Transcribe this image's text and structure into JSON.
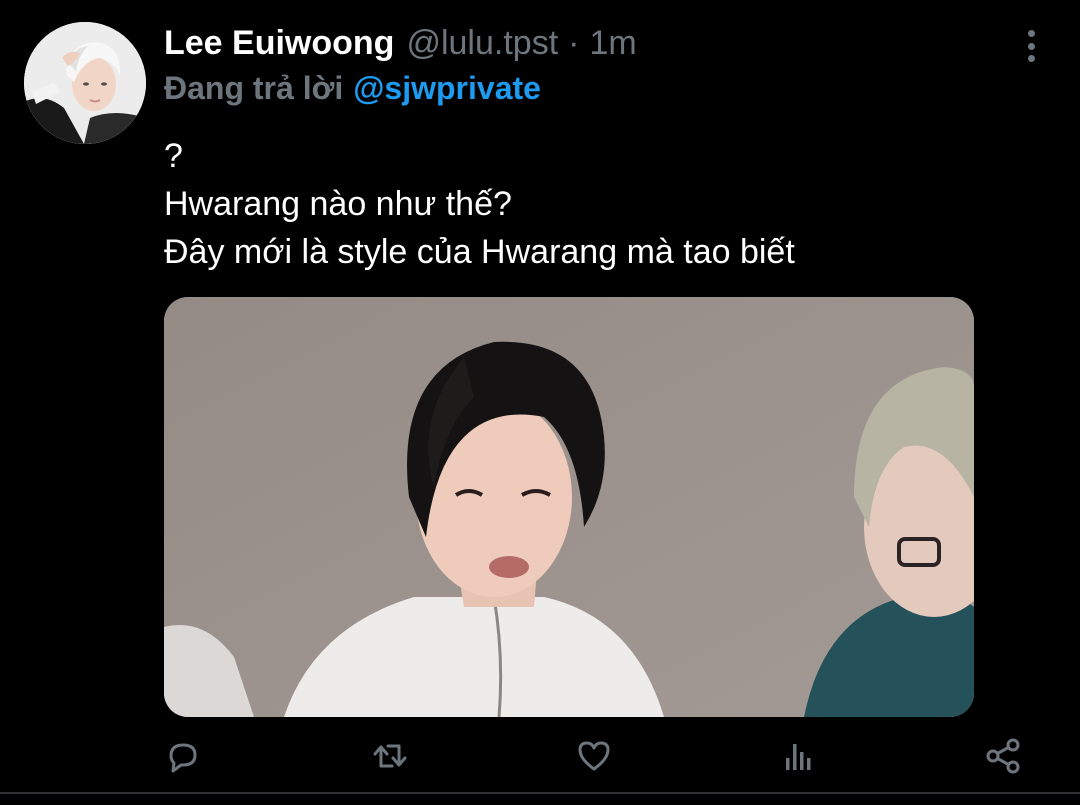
{
  "author": {
    "display_name": "Lee Euiwoong",
    "handle": "@lulu.tpst",
    "separator": "·",
    "time": "1m"
  },
  "reply": {
    "prefix": "Đang trả lời",
    "mention": "@sjwprivate"
  },
  "tweet": {
    "lines": [
      "?",
      "Hwarang nào như thế?",
      "Đây mới là style của Hwarang mà tao biết"
    ]
  },
  "actions": {
    "reply": "reply-icon",
    "retweet": "retweet-icon",
    "like": "heart-icon",
    "analytics": "analytics-icon",
    "share": "share-icon"
  },
  "colors": {
    "background": "#000000",
    "primary_text": "#ffffff",
    "secondary_text": "#6e767d",
    "accent": "#1d9bf0",
    "divider": "#2f3336"
  }
}
